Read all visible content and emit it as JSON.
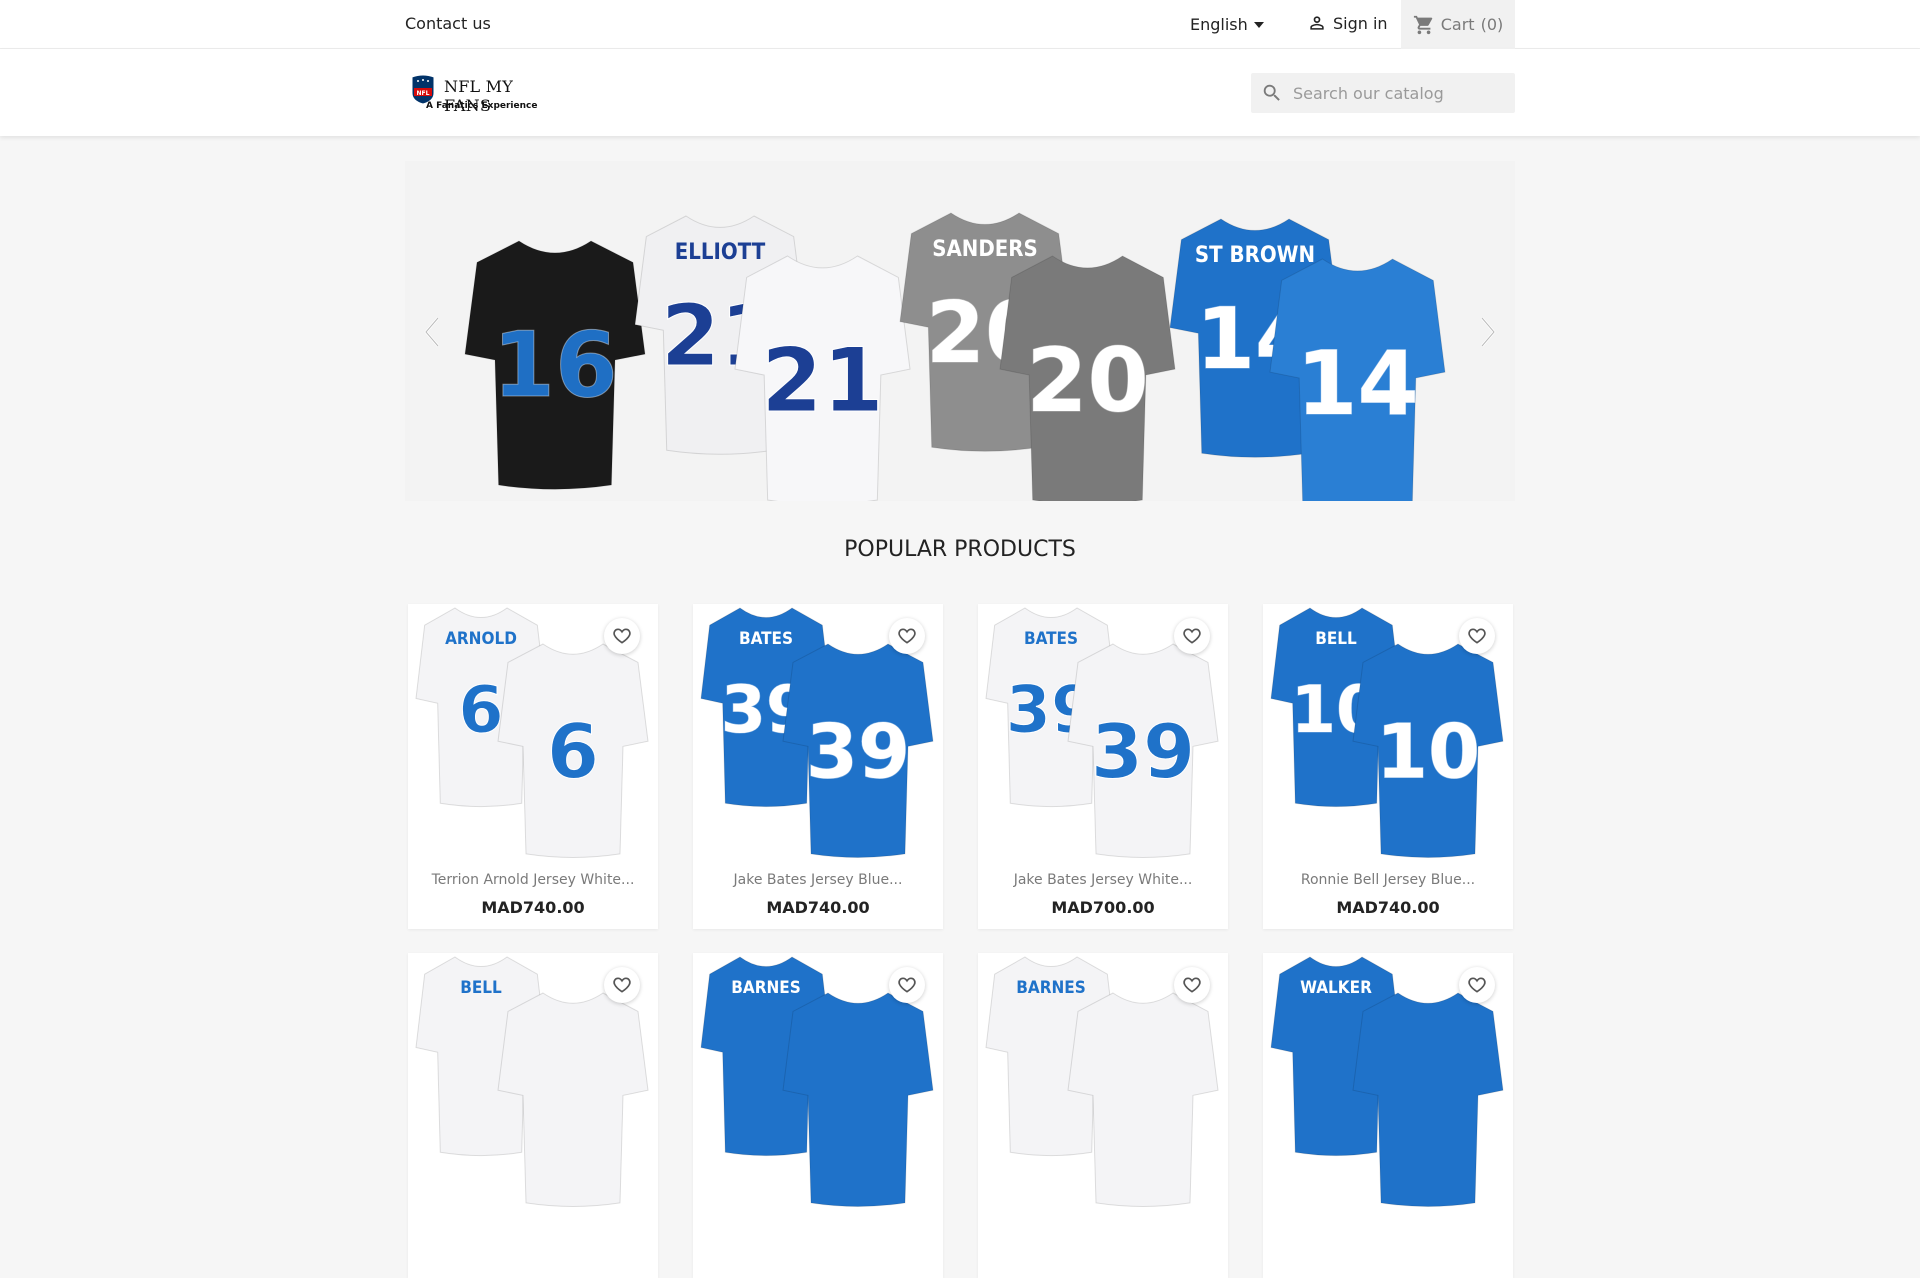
{
  "topbar": {
    "contact_label": "Contact us",
    "language_label": "English",
    "signin_label": "Sign in",
    "cart_label": "Cart",
    "cart_count": "(0)"
  },
  "header": {
    "logo_title": "NFL MY FANS",
    "logo_subtitle": "A Fanatics Experience",
    "search_placeholder": "Search our catalog"
  },
  "slider": {
    "jerseys": [
      {
        "name": "",
        "number": "16",
        "color": "#1a1a1a",
        "accent": "#1f6fc4"
      },
      {
        "name": "ELLIOTT",
        "number": "21",
        "color": "#f0f0f2",
        "accent": "#1c3f94"
      },
      {
        "name": "",
        "number": "21",
        "color": "#f7f7f9",
        "accent": "#1c3f94"
      },
      {
        "name": "SANDERS",
        "number": "20",
        "color": "#8e8e8e",
        "accent": "#ffffff"
      },
      {
        "name": "",
        "number": "20",
        "color": "#7a7a7a",
        "accent": "#ffffff"
      },
      {
        "name": "ST BROWN",
        "number": "14",
        "color": "#1f72c9",
        "accent": "#ffffff"
      },
      {
        "name": "",
        "number": "14",
        "color": "#2a7fd4",
        "accent": "#ffffff"
      }
    ]
  },
  "section": {
    "title": "POPULAR PRODUCTS"
  },
  "products": [
    {
      "name": "Terrion Arnold Jersey White...",
      "price": "MAD740.00",
      "back_name": "ARNOLD",
      "number": "6",
      "color": "#f4f4f6",
      "digit": "#1f72c9"
    },
    {
      "name": "Jake Bates Jersey Blue...",
      "price": "MAD740.00",
      "back_name": "BATES",
      "number": "39",
      "color": "#1f72c9",
      "digit": "#ffffff"
    },
    {
      "name": "Jake Bates Jersey White...",
      "price": "MAD700.00",
      "back_name": "BATES",
      "number": "39",
      "color": "#f4f4f6",
      "digit": "#1f72c9"
    },
    {
      "name": "Ronnie Bell Jersey Blue...",
      "price": "MAD740.00",
      "back_name": "BELL",
      "number": "10",
      "color": "#1f72c9",
      "digit": "#ffffff"
    }
  ],
  "products_row2": [
    {
      "back_name": "BELL",
      "color": "#f4f4f6",
      "digit": "#1f72c9"
    },
    {
      "back_name": "BARNES",
      "color": "#1f72c9",
      "digit": "#ffffff"
    },
    {
      "back_name": "BARNES",
      "color": "#f4f4f6",
      "digit": "#1f72c9"
    },
    {
      "back_name": "WALKER",
      "color": "#1f72c9",
      "digit": "#ffffff"
    }
  ]
}
